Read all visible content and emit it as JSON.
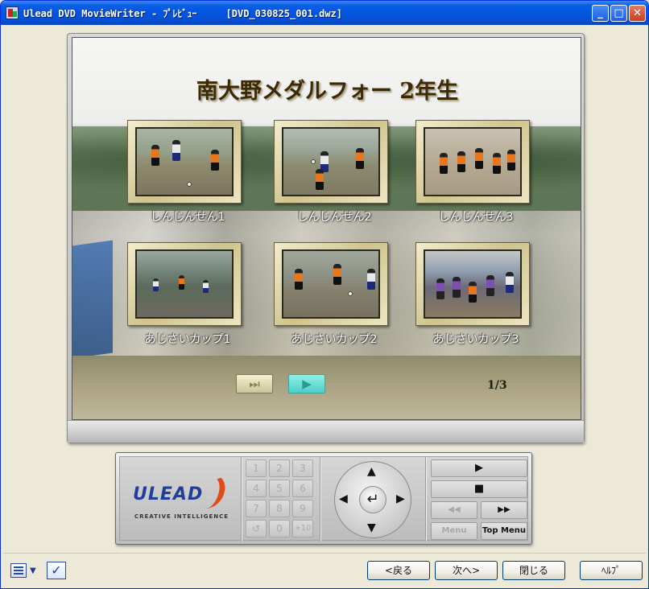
{
  "window": {
    "title": "Ulead DVD MovieWriter - ﾌﾟﾚﾋﾞｭｰ     [DVD_030825_001.dwz]",
    "minimize_label": "_",
    "maximize_label": "□",
    "close_label": "✕"
  },
  "menu": {
    "title": "南大野メダルフォー 2年生",
    "items": [
      {
        "label": "しんじんせん1"
      },
      {
        "label": "しんじんせん2"
      },
      {
        "label": "しんじんせん3"
      },
      {
        "label": "あじさいカップ1"
      },
      {
        "label": "あじさいカップ2"
      },
      {
        "label": "あじさいカップ3"
      }
    ],
    "next_page_icon": "⏭",
    "play_icon": "▶",
    "page_indicator": "1/3"
  },
  "remote": {
    "logo_text": "ULEAD",
    "logo_tagline": "CREATIVE INTELLIGENCE",
    "numpad": [
      "1",
      "2",
      "3",
      "4",
      "5",
      "6",
      "7",
      "8",
      "9",
      "↺",
      "0",
      "+10"
    ],
    "dpad": {
      "up": "▲",
      "down": "▼",
      "left": "◀",
      "right": "▶",
      "enter": "↵"
    },
    "play_label": "▶",
    "stop_label": "■",
    "rewind_label": "◀◀",
    "fastforward_label": "▶▶",
    "menu_label": "Menu",
    "top_menu_label": "Top Menu"
  },
  "footer": {
    "check_label": "✓",
    "back_label": "<戻る",
    "next_label": "次へ>",
    "close_label": "閉じる",
    "help_label": "ﾍﾙﾌﾟ"
  }
}
